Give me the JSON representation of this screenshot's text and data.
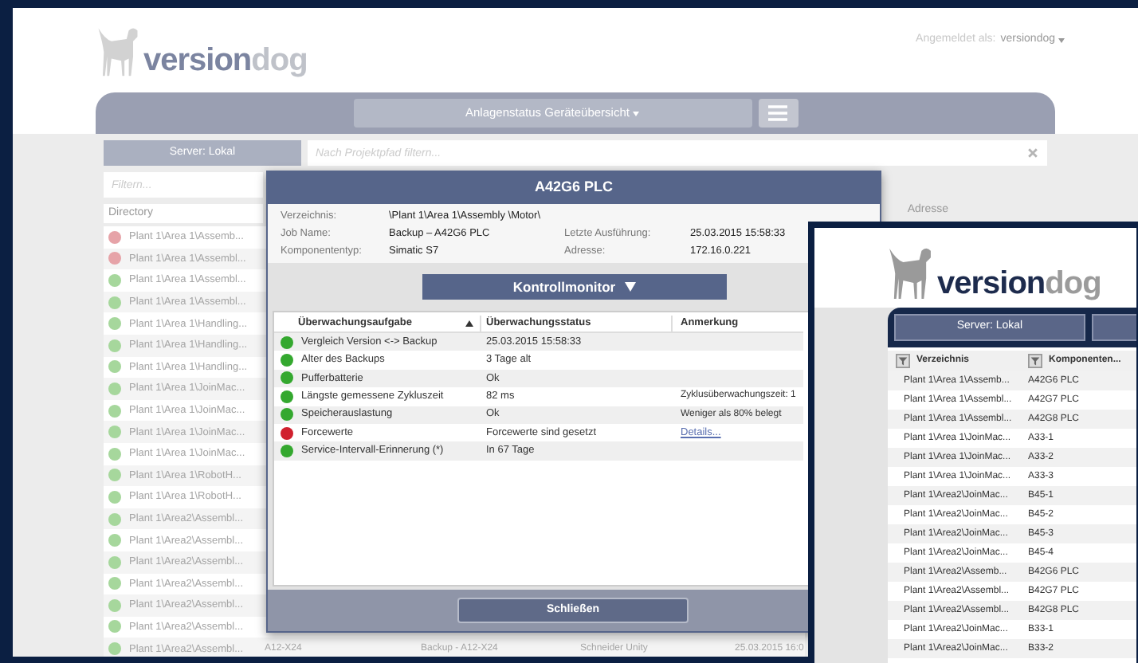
{
  "app": {
    "logo": {
      "word_1": "version",
      "word_2": "dog"
    },
    "login": {
      "label": "Angemeldet als:",
      "user": "versiondog"
    },
    "nav": {
      "view_button": "Anlagenstatus Geräteübersicht"
    },
    "server_button": "Server: Lokal",
    "path_filter": {
      "placeholder": "Nach Projektpfad filtern..."
    },
    "list_filter": {
      "placeholder": "Filtern..."
    },
    "list_header": "Directory",
    "column_header": "Adresse",
    "rows": [
      {
        "path": "Plant 1\\Area 1\\Assemb...",
        "color": "#e6a3a8"
      },
      {
        "path": "Plant 1\\Area 1\\Assembl...",
        "color": "#e6a3a8"
      },
      {
        "path": "Plant 1\\Area 1\\Assembl...",
        "color": "#a6d79c"
      },
      {
        "path": "Plant 1\\Area 1\\Assembl...",
        "color": "#a6d79c"
      },
      {
        "path": "Plant 1\\Area 1\\Handling...",
        "color": "#a6d79c"
      },
      {
        "path": "Plant 1\\Area 1\\Handling...",
        "color": "#a6d79c"
      },
      {
        "path": "Plant 1\\Area 1\\Handling...",
        "color": "#a6d79c"
      },
      {
        "path": "Plant 1\\Area 1\\JoinMac...",
        "color": "#a6d79c"
      },
      {
        "path": "Plant 1\\Area 1\\JoinMac...",
        "color": "#a6d79c"
      },
      {
        "path": "Plant 1\\Area 1\\JoinMac...",
        "color": "#a6d79c"
      },
      {
        "path": "Plant 1\\Area 1\\JoinMac...",
        "color": "#a6d79c"
      },
      {
        "path": "Plant 1\\Area 1\\RobotH...",
        "color": "#a6d79c"
      },
      {
        "path": "Plant 1\\Area 1\\RobotH...",
        "color": "#a6d79c"
      },
      {
        "path": "Plant 1\\Area2\\Assembl...",
        "color": "#a6d79c"
      },
      {
        "path": "Plant 1\\Area2\\Assembl...",
        "color": "#a6d79c"
      },
      {
        "path": "Plant 1\\Area2\\Assembl...",
        "color": "#a6d79c"
      },
      {
        "path": "Plant 1\\Area2\\Assembl...",
        "color": "#a6d79c"
      },
      {
        "path": "Plant 1\\Area2\\Assembl...",
        "color": "#a6d79c"
      },
      {
        "path": "Plant 1\\Area2\\Assembl...",
        "color": "#a6d79c"
      },
      {
        "path": "Plant 1\\Area2\\Assembl...",
        "color": "#a6d79c",
        "cells": [
          "A12-X24",
          "Backup - A12-X24",
          "Schneider Unity",
          "25.03.2015 16:0"
        ]
      }
    ]
  },
  "modal": {
    "title": "A42G6 PLC",
    "info": [
      {
        "label": "Verzeichnis:",
        "value": "\\Plant 1\\Area 1\\Assembly \\Motor\\"
      },
      {
        "label": "Job Name:",
        "value": "Backup – A42G6 PLC",
        "label_2": "Letzte Ausführung:",
        "value_2": "25.03.2015 15:58:33"
      },
      {
        "label": "Komponententyp:",
        "value": "Simatic S7",
        "label_2": "Adresse:",
        "value_2": "172.16.0.221"
      }
    ],
    "monitor_button": "Kontrollmonitor",
    "columns": [
      "Überwachungsaufgabe",
      "Überwachungsstatus",
      "Anmerkung"
    ],
    "rows": [
      {
        "color": "#34a82f",
        "task": "Vergleich Version <-> Backup",
        "status": "25.03.2015 15:58:33"
      },
      {
        "color": "#34a82f",
        "task": "Alter des Backups",
        "status": "3 Tage alt"
      },
      {
        "color": "#34a82f",
        "task": "Pufferbatterie",
        "status": "Ok"
      },
      {
        "color": "#34a82f",
        "task": "Längste gemessene Zykluszeit",
        "status": "82 ms",
        "note": "Zyklusüberwachungszeit: 1",
        "link": false
      },
      {
        "color": "#34a82f",
        "task": "Speicherauslastung",
        "status": "Ok",
        "note": "Weniger als 80% belegt",
        "link": false
      },
      {
        "color": "#d0202e",
        "task": "Forcewerte",
        "status": "Forcewerte sind gesetzt",
        "note": "Details...",
        "link": true
      },
      {
        "color": "#34a82f",
        "task": "Service-Intervall-Erinnerung (*)",
        "status": "In 67 Tage"
      }
    ],
    "close_button": "Schließen"
  },
  "second_window": {
    "logo": {
      "word_1": "version",
      "word_2": "dog"
    },
    "server_button": "Server: Lokal",
    "columns": [
      "Verzeichnis",
      "Komponenten..."
    ],
    "rows": [
      [
        "Plant 1\\Area 1\\Assemb...",
        "A42G6 PLC"
      ],
      [
        "Plant 1\\Area 1\\Assembl...",
        "A42G7 PLC"
      ],
      [
        "Plant 1\\Area 1\\Assembl...",
        "A42G8 PLC"
      ],
      [
        "Plant 1\\Area 1\\JoinMac...",
        "A33-1"
      ],
      [
        "Plant 1\\Area 1\\JoinMac...",
        "A33-2"
      ],
      [
        "Plant 1\\Area 1\\JoinMac...",
        "A33-3"
      ],
      [
        "Plant 1\\Area2\\JoinMac...",
        "B45-1"
      ],
      [
        "Plant 1\\Area2\\JoinMac...",
        "B45-2"
      ],
      [
        "Plant 1\\Area2\\JoinMac...",
        "B45-3"
      ],
      [
        "Plant 1\\Area2\\JoinMac...",
        "B45-4"
      ],
      [
        "Plant 1\\Area2\\Assemb...",
        "B42G6 PLC"
      ],
      [
        "Plant 1\\Area2\\Assembl...",
        "B42G7 PLC"
      ],
      [
        "Plant 1\\Area2\\Assembl...",
        "B42G8 PLC"
      ],
      [
        "Plant 1\\Area2\\JoinMac...",
        "B33-1"
      ],
      [
        "Plant 1\\Area2\\JoinMac...",
        "B33-2"
      ]
    ]
  }
}
